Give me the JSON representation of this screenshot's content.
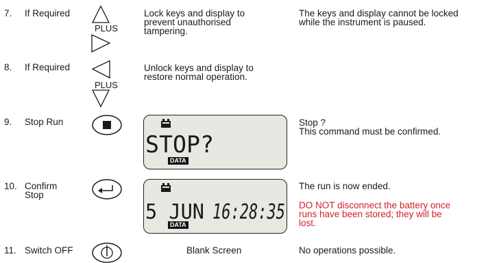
{
  "steps": [
    {
      "number": "7.",
      "action": "If Required",
      "key_icons": [
        "up-triangle-icon",
        "right-triangle-icon"
      ],
      "key_label": "PLUS",
      "description": "Lock keys and display to\nprevent unauthorised\ntampering.",
      "note": "The keys and display cannot be locked\nwhile the instrument is paused."
    },
    {
      "number": "8.",
      "action": "If Required",
      "key_icons": [
        "left-triangle-icon",
        "down-triangle-icon"
      ],
      "key_label": "PLUS",
      "description": "Unlock keys and display to\nrestore normal operation."
    },
    {
      "number": "9.",
      "action": "Stop Run",
      "key_icons": [
        "stop-icon"
      ],
      "display": {
        "text": "STOP?",
        "badge": "DATA",
        "icon": "battery-icon"
      },
      "note": "Stop ?\nThis command must be confirmed."
    },
    {
      "number": "10.",
      "action": "Confirm\nStop",
      "key_icons": [
        "enter-arrow-icon"
      ],
      "display": {
        "date": "5 JUN",
        "time": "16:28:35",
        "badge": "DATA",
        "icon": "battery-icon"
      },
      "note": "The run is now ended.",
      "warning": "DO NOT disconnect the battery once\nruns have been stored; they will be\nlost.",
      "warning_color": "#d0202a"
    },
    {
      "number": "11.",
      "action": "Switch OFF",
      "key_icons": [
        "power-icon"
      ],
      "display_text": "Blank Screen",
      "note": "No operations possible."
    }
  ]
}
